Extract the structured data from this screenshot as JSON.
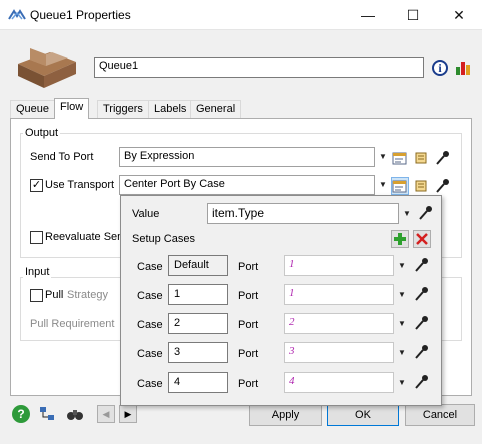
{
  "window": {
    "title": "Queue1  Properties",
    "minimize_glyph": "—",
    "maximize_glyph": "☐",
    "close_glyph": "✕"
  },
  "header": {
    "name_value": "Queue1",
    "info_glyph": "i"
  },
  "tabs": [
    "Queue",
    "Flow",
    "Triggers",
    "Labels",
    "General"
  ],
  "active_tab": "Flow",
  "output": {
    "group_title": "Output",
    "send_to_port_label": "Send To Port",
    "send_to_port_value": "By Expression",
    "use_transport_label": "Use Transport",
    "use_transport_checked": true,
    "use_transport_value": "Center Port By Case",
    "reevaluate_label": "Reevaluate Sen"
  },
  "input": {
    "group_title": "Input",
    "pull_label": "Pull",
    "strategy_label": "Strategy",
    "pull_requirement_label": "Pull Requirement"
  },
  "popup": {
    "value_label": "Value",
    "value_text": "item.Type",
    "setup_cases_label": "Setup Cases",
    "case_label": "Case",
    "port_label": "Port",
    "cases": [
      {
        "case": "Default",
        "port": "1"
      },
      {
        "case": "1",
        "port": "1"
      },
      {
        "case": "2",
        "port": "2"
      },
      {
        "case": "3",
        "port": "3"
      },
      {
        "case": "4",
        "port": "4"
      }
    ]
  },
  "footer": {
    "help_glyph": "?",
    "prev_glyph": "◀",
    "next_glyph": "▶",
    "apply_label": "Apply",
    "ok_label": "OK",
    "cancel_label": "Cancel"
  },
  "colors": {
    "accent_blue": "#0078d7",
    "port_text": "#b028b0",
    "add_green": "#2ea02e",
    "remove_red": "#d42020"
  }
}
